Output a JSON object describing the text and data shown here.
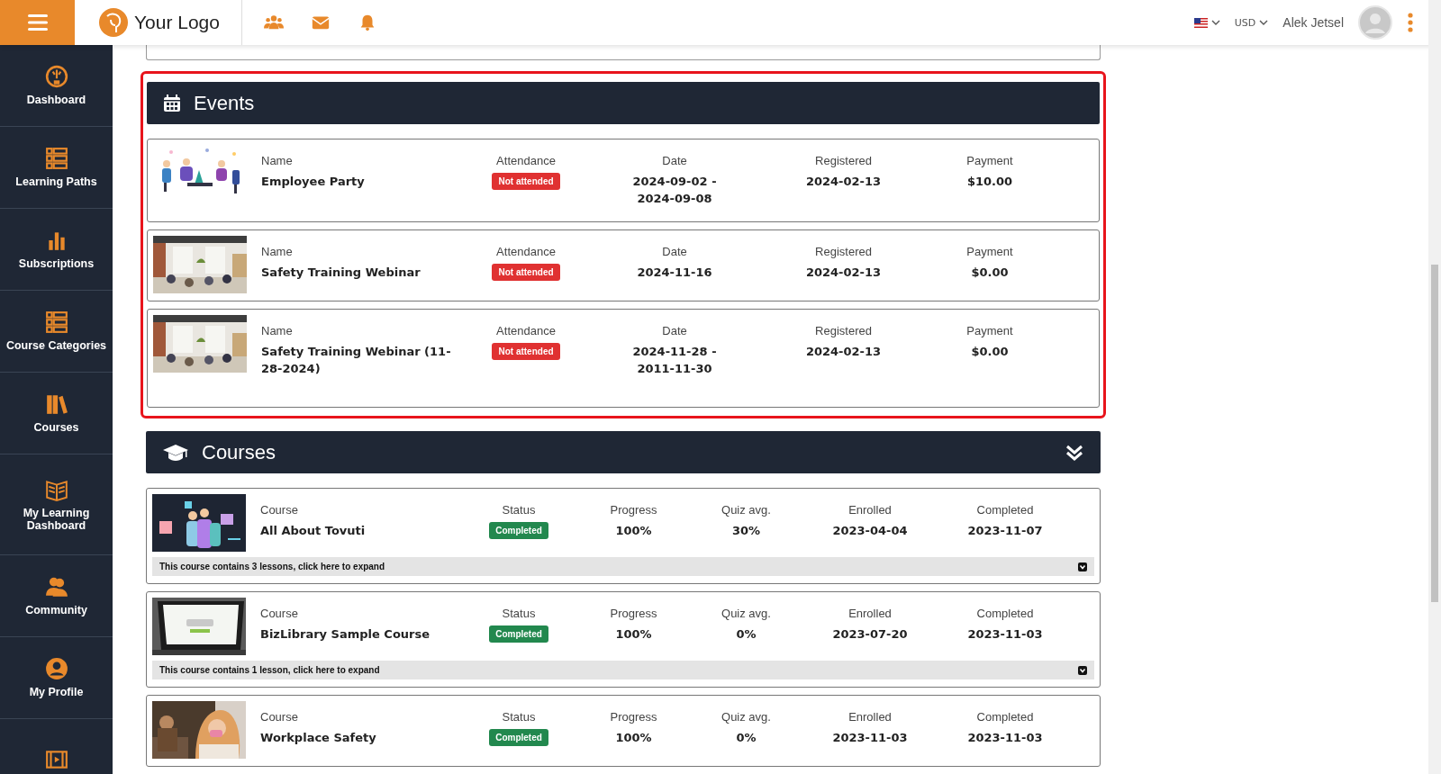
{
  "header": {
    "logo_text": "Your Logo",
    "currency": "USD",
    "user_name": "Alek Jetsel"
  },
  "sidebar": {
    "items": [
      {
        "kind": "labeled",
        "label": "Dashboard"
      },
      {
        "kind": "labeled",
        "label": "Learning Paths"
      },
      {
        "kind": "labeled",
        "label": "Subscriptions"
      },
      {
        "kind": "labeled",
        "label": "Course Categories"
      },
      {
        "kind": "labeled",
        "label": "Courses"
      },
      {
        "kind": "labeled",
        "label": "My Learning Dashboard"
      },
      {
        "kind": "labeled",
        "label": "Community"
      },
      {
        "kind": "labeled",
        "label": "My Profile"
      },
      {
        "kind": "icon_only"
      }
    ]
  },
  "events": {
    "title": "Events",
    "rows": [
      {
        "name_label": "Name",
        "name": "Employee Party",
        "attendance_label": "Attendance",
        "attendance": "Not attended",
        "attended": false,
        "date_label": "Date",
        "date": "2024-09-02 - 2024-09-08",
        "registered_label": "Registered",
        "registered": "2024-02-13",
        "payment_label": "Payment",
        "payment": "$10.00"
      },
      {
        "name_label": "Name",
        "name": "Safety Training Webinar",
        "attendance_label": "Attendance",
        "attendance": "Not attended",
        "attended": false,
        "date_label": "Date",
        "date": "2024-11-16",
        "registered_label": "Registered",
        "registered": "2024-02-13",
        "payment_label": "Payment",
        "payment": "$0.00"
      },
      {
        "name_label": "Name",
        "name": "Safety Training Webinar (11-28-2024)",
        "attendance_label": "Attendance",
        "attendance": "Not attended",
        "attended": false,
        "date_label": "Date",
        "date": "2024-11-28 - 2011-11-30",
        "registered_label": "Registered",
        "registered": "2024-02-13",
        "payment_label": "Payment",
        "payment": "$0.00"
      }
    ]
  },
  "courses": {
    "title": "Courses",
    "rows": [
      {
        "course_label": "Course",
        "name": "All About Tovuti",
        "status_label": "Status",
        "status": "Completed",
        "completed": true,
        "progress_label": "Progress",
        "progress": "100%",
        "quiz_label": "Quiz avg.",
        "quiz": "30%",
        "enrolled_label": "Enrolled",
        "enrolled": "2023-04-04",
        "completed_label": "Completed",
        "completed_date": "2023-11-07",
        "lessons_note": "This course contains 3 lessons, click here to expand"
      },
      {
        "course_label": "Course",
        "name": "BizLibrary Sample Course",
        "status_label": "Status",
        "status": "Completed",
        "completed": true,
        "progress_label": "Progress",
        "progress": "100%",
        "quiz_label": "Quiz avg.",
        "quiz": "0%",
        "enrolled_label": "Enrolled",
        "enrolled": "2023-07-20",
        "completed_label": "Completed",
        "completed_date": "2023-11-03",
        "lessons_note": "This course contains 1 lesson, click here to expand"
      },
      {
        "course_label": "Course",
        "name": "Workplace Safety",
        "status_label": "Status",
        "status": "Completed",
        "completed": true,
        "progress_label": "Progress",
        "progress": "100%",
        "quiz_label": "Quiz avg.",
        "quiz": "0%",
        "enrolled_label": "Enrolled",
        "enrolled": "2023-11-03",
        "completed_label": "Completed",
        "completed_date": "2023-11-03"
      }
    ]
  }
}
